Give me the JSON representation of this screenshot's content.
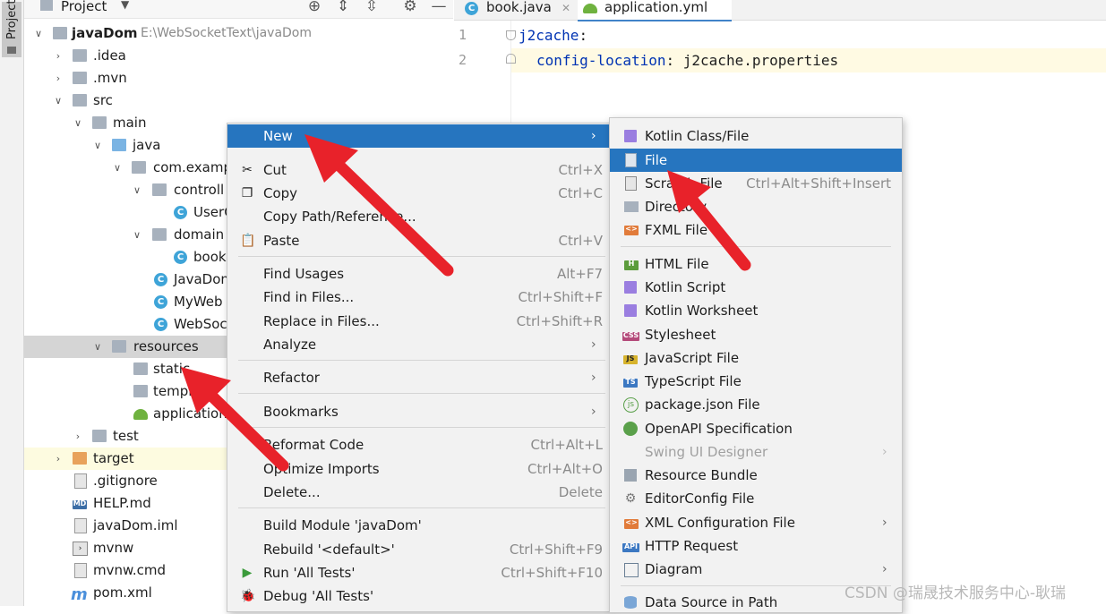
{
  "sidebar": {
    "label": "Project"
  },
  "project_panel": {
    "title": "Project",
    "tree": [
      {
        "name": "javaDom",
        "path": "E:\\WebSocketText\\javaDom"
      },
      {
        "name": ".idea"
      },
      {
        "name": ".mvn"
      },
      {
        "name": "src"
      },
      {
        "name": "main"
      },
      {
        "name": "java"
      },
      {
        "name": "com.examp"
      },
      {
        "name": "controll"
      },
      {
        "name": "UserC"
      },
      {
        "name": "domain"
      },
      {
        "name": "book"
      },
      {
        "name": "JavaDom"
      },
      {
        "name": "MyWeb"
      },
      {
        "name": "WebSoc"
      },
      {
        "name": "resources"
      },
      {
        "name": "static"
      },
      {
        "name": "templ"
      },
      {
        "name": "application"
      },
      {
        "name": "test"
      },
      {
        "name": "target"
      },
      {
        "name": ".gitignore"
      },
      {
        "name": "HELP.md"
      },
      {
        "name": "javaDom.iml"
      },
      {
        "name": "mvnw"
      },
      {
        "name": "mvnw.cmd"
      },
      {
        "name": "pom.xml"
      }
    ]
  },
  "editor": {
    "tabs": [
      {
        "label": "book.java"
      },
      {
        "label": "application.yml"
      }
    ],
    "lines": [
      {
        "num": "1",
        "key": "j2cache",
        "sep": ":",
        "value": ""
      },
      {
        "num": "2",
        "key": "config-location",
        "sep": ":",
        "value": " j2cache.properties"
      }
    ]
  },
  "context_menu": {
    "items": [
      {
        "label": "New",
        "shortcut": ""
      },
      {
        "label": "Cut",
        "shortcut": "Ctrl+X"
      },
      {
        "label": "Copy",
        "shortcut": "Ctrl+C"
      },
      {
        "label": "Copy Path/Reference...",
        "shortcut": ""
      },
      {
        "label": "Paste",
        "shortcut": "Ctrl+V"
      },
      {
        "label": "Find Usages",
        "shortcut": "Alt+F7"
      },
      {
        "label": "Find in Files...",
        "shortcut": "Ctrl+Shift+F"
      },
      {
        "label": "Replace in Files...",
        "shortcut": "Ctrl+Shift+R"
      },
      {
        "label": "Analyze",
        "shortcut": ""
      },
      {
        "label": "Refactor",
        "shortcut": ""
      },
      {
        "label": "Bookmarks",
        "shortcut": ""
      },
      {
        "label": "Reformat Code",
        "shortcut": "Ctrl+Alt+L"
      },
      {
        "label": "Optimize Imports",
        "shortcut": "Ctrl+Alt+O"
      },
      {
        "label": "Delete...",
        "shortcut": "Delete"
      },
      {
        "label": "Build Module 'javaDom'",
        "shortcut": ""
      },
      {
        "label": "Rebuild '<default>'",
        "shortcut": "Ctrl+Shift+F9"
      },
      {
        "label": "Run 'All Tests'",
        "shortcut": "Ctrl+Shift+F10"
      },
      {
        "label": "Debug 'All Tests'",
        "shortcut": ""
      }
    ]
  },
  "new_submenu": {
    "items": [
      {
        "label": "Kotlin Class/File",
        "shortcut": ""
      },
      {
        "label": "File",
        "shortcut": ""
      },
      {
        "label": "Scratch File",
        "shortcut": "Ctrl+Alt+Shift+Insert"
      },
      {
        "label": "Directory",
        "shortcut": ""
      },
      {
        "label": "FXML File",
        "shortcut": ""
      },
      {
        "label": "HTML File",
        "shortcut": ""
      },
      {
        "label": "Kotlin Script",
        "shortcut": ""
      },
      {
        "label": "Kotlin Worksheet",
        "shortcut": ""
      },
      {
        "label": "Stylesheet",
        "shortcut": ""
      },
      {
        "label": "JavaScript File",
        "shortcut": ""
      },
      {
        "label": "TypeScript File",
        "shortcut": ""
      },
      {
        "label": "package.json File",
        "shortcut": ""
      },
      {
        "label": "OpenAPI Specification",
        "shortcut": ""
      },
      {
        "label": "Swing UI Designer",
        "shortcut": ""
      },
      {
        "label": "Resource Bundle",
        "shortcut": ""
      },
      {
        "label": "EditorConfig File",
        "shortcut": ""
      },
      {
        "label": "XML Configuration File",
        "shortcut": ""
      },
      {
        "label": "HTTP Request",
        "shortcut": ""
      },
      {
        "label": "Diagram",
        "shortcut": ""
      },
      {
        "label": "Data Source in Path",
        "shortcut": ""
      }
    ]
  },
  "icon_badges": {
    "md": "MD",
    "html": "H",
    "css": "CSS",
    "js": "JS",
    "ts": "TS",
    "api": "API",
    "fxml": "<>",
    "xml": "<>",
    "java": "C"
  },
  "watermark": "CSDN @瑞晟技术服务中心-耿瑞",
  "colors": {
    "selection": "#2675bf",
    "annotation_arrow": "#e8222a",
    "class_icon": "#3ea4d8",
    "highlight_row": "#d5d5d5"
  }
}
